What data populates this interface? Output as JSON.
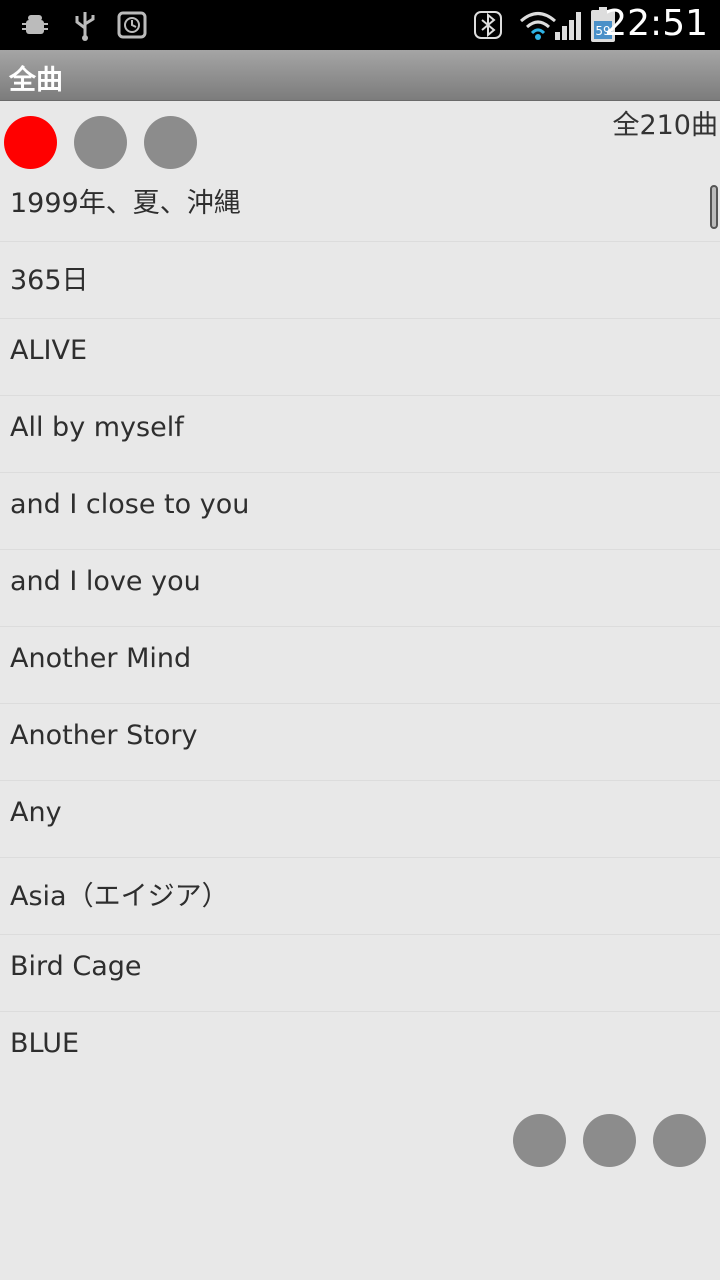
{
  "status_bar": {
    "time": "22:51",
    "icons": [
      "android-debug-icon",
      "usb-icon",
      "alarm-icon",
      "bluetooth-sync-icon",
      "wifi-icon",
      "signal-icon",
      "battery-icon"
    ],
    "battery_level": "59"
  },
  "header": {
    "title": "全曲"
  },
  "count": "全210曲",
  "colors": {
    "active_dot": "#ff0000",
    "inactive_dot": "#8c8c8c",
    "title_bar": "#8e8e8e",
    "background": "#e8e8e8"
  },
  "songs": [
    "1999年、夏、沖縄",
    "365日",
    "ALIVE",
    "All by myself",
    "and I close to you",
    "and I love you",
    "Another Mind",
    "Another Story",
    "Any",
    "Asia（エイジア）",
    "Bird Cage",
    "BLUE"
  ]
}
